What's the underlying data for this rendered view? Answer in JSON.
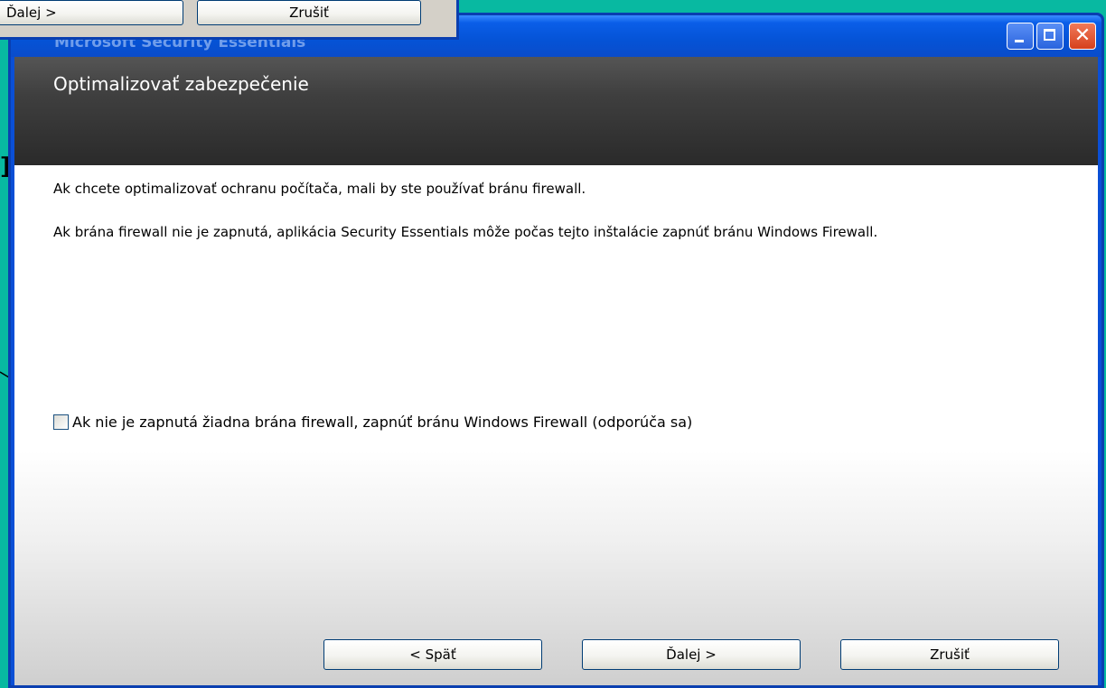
{
  "window": {
    "title": "Microsoft Security Essentials",
    "colors": {
      "titlebar": "#0553d6",
      "background": "#08b9a1",
      "banner": "#3f3f3f"
    }
  },
  "banner": {
    "title": "Optimalizovať zabezpečenie"
  },
  "content": {
    "paragraph1": "Ak chcete optimalizovať ochranu počítača, mali by ste používať bránu firewall.",
    "paragraph2": "Ak brána firewall nie je zapnutá, aplikácia Security Essentials môže počas tejto inštalácie zapnúť bránu Windows Firewall.",
    "checkbox": {
      "label": "Ak nie je zapnutá žiadna brána firewall, zapnúť bránu Windows Firewall (odporúča sa)",
      "checked": false
    }
  },
  "footer": {
    "back": "< Späť",
    "next": "Ďalej >",
    "cancel": "Zrušiť"
  },
  "overlay": {
    "next": "Ďalej >",
    "cancel": "Zrušiť"
  },
  "stray_glyph": "n",
  "icons": [
    "minimize-icon",
    "maximize-icon",
    "close-icon",
    "arrow-pointer-icon"
  ]
}
